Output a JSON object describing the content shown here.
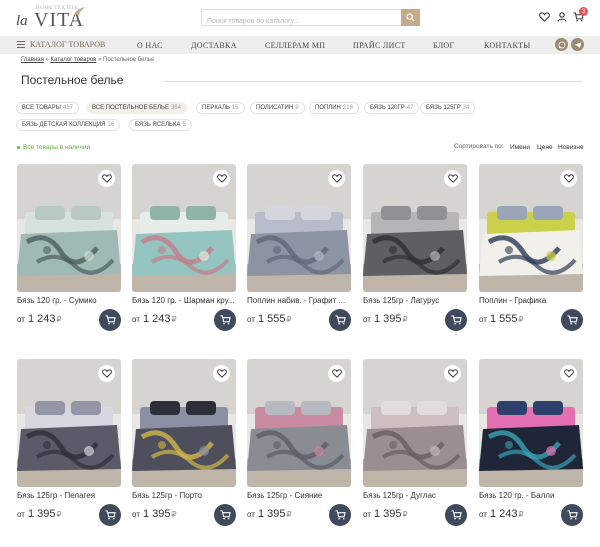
{
  "header": {
    "logo_tagline": "HOME TEXTILE",
    "logo_la": "la",
    "logo_vita": "VITA",
    "search_placeholder": "Поиск товаров по каталогу...",
    "cart_count": "3"
  },
  "nav": {
    "catalog_label": "КАТАЛОГ ТОВАРОВ",
    "items": [
      "О НАС",
      "ДОСТАВКА",
      "СЕЛЛЕРАМ МП",
      "ПРАЙС ЛИСТ",
      "БЛОГ",
      "КОНТАКТЫ"
    ]
  },
  "breadcrumb": {
    "home": "Главная",
    "sep1": "»",
    "catalog": "Каталог товаров",
    "sep2": "»",
    "current": "Постельное белье"
  },
  "page_title": "Постельное белье",
  "filters": [
    {
      "label": "ВСЕ ТОВАРЫ",
      "count": "487"
    },
    {
      "label": "ВСЕ ПОСТЕЛЬНОЕ БЕЛЬЕ",
      "count": "384"
    },
    {
      "label": "ПЕРКАЛЬ",
      "count": "15"
    },
    {
      "label": "ПОЛИСАТИН",
      "count": "9"
    },
    {
      "label": "ПОПЛИН",
      "count": "218"
    },
    {
      "label": "БЯЗЬ 120ГР",
      "count": "47"
    },
    {
      "label": "БЯЗЬ 125ГР",
      "count": "34"
    },
    {
      "label": "БЯЗЬ ДЕТСКАЯ КОЛЛЕКЦИЯ",
      "count": "16"
    },
    {
      "label": "БЯЗЬ ЯСЕЛЬКА",
      "count": "5"
    }
  ],
  "stock_label": "Все товары в наличии",
  "sort": {
    "label": "Сортировать по:",
    "options": [
      "Имени",
      "Цене",
      "Новизне"
    ]
  },
  "price_prefix": "от",
  "currency_symbol": "₽",
  "products": [
    {
      "name": "Бязь 120 гр. - Сумико",
      "price": "1 243"
    },
    {
      "name": "Бязь 120 гр. - Шарман кру...",
      "price": "1 243"
    },
    {
      "name": "Поплин набив. - Графит ...",
      "price": "1 555"
    },
    {
      "name": "Бязь 125гр - Лагурус",
      "price": "1 395"
    },
    {
      "name": "Поплин - Графика",
      "price": "1 555"
    },
    {
      "name": "Бязь 125гр - Пелагея",
      "price": "1 395"
    },
    {
      "name": "Бязь 125гр - Порто",
      "price": "1 395"
    },
    {
      "name": "Бязь 125гр - Сияние",
      "price": "1 395"
    },
    {
      "name": "Бязь 125гр - Дуглас",
      "price": "1 395"
    },
    {
      "name": "Бязь 120 гр. - Балли",
      "price": "1 243"
    }
  ],
  "colors": {
    "accent": "#c3ab8c",
    "nav_bg": "#eeeeee",
    "cart_button": "#3f4a5c",
    "stock_green": "#6aaa4a",
    "badge_red": "#e85555"
  },
  "icons": [
    "search-icon",
    "heart-icon",
    "user-icon",
    "cart-icon",
    "menu-icon",
    "whatsapp-icon",
    "telegram-icon"
  ]
}
